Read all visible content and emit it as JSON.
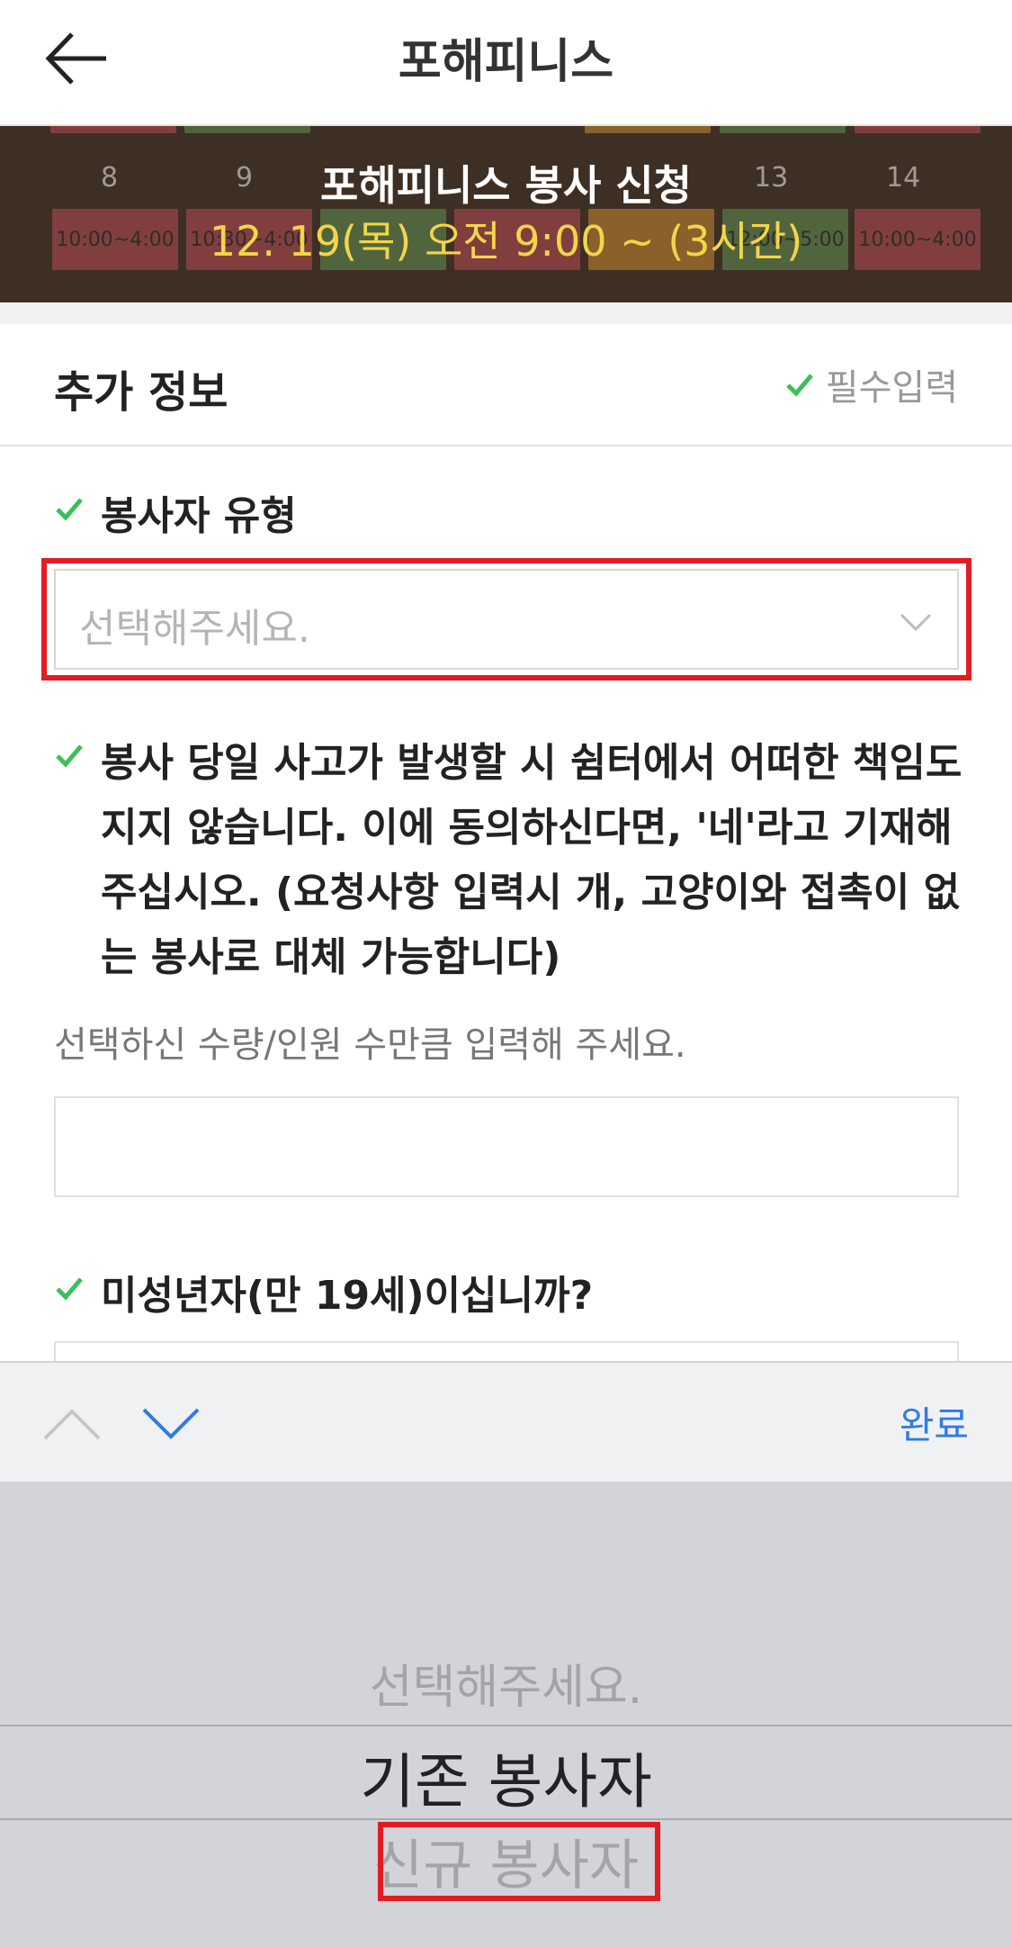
{
  "header": {
    "title": "포해피니스",
    "back_icon": "arrow-left-icon"
  },
  "banner": {
    "title": "포해피니스 봉사 신청",
    "subtitle": "12. 19(목) 오전 9:00 ~ (3시간)",
    "calendar_numbers": [
      "8",
      "9",
      "13",
      "14"
    ],
    "calendar_times": [
      "10:00~4:00",
      "10:30~4:00",
      "12:00~5:00",
      "10:00~4:00"
    ],
    "colors": {
      "red": "#c2575c",
      "green": "#6b9b5a",
      "orange": "#d4923a",
      "title": "#ffffff",
      "subtitle": "#f3d54a"
    }
  },
  "section": {
    "title": "추가 정보",
    "required_label": "필수입력"
  },
  "fields": {
    "volunteer_type": {
      "label": "봉사자 유형",
      "placeholder": "선택해주세요."
    },
    "agreement": {
      "label": "봉사 당일 사고가 발생할 시 쉼터에서 어떠한 책임도 지지 않습니다. 이에 동의하신다면, '네'라고 기재해 주십시오. (요청사항 입력시 개, 고양이와 접촉이 없는 봉사로 대체 가능합니다)",
      "hint": "선택하신 수량/인원 수만큼 입력해 주세요.",
      "value": ""
    },
    "minor": {
      "label": "미성년자(만 19세)이십니까?"
    }
  },
  "keyboard_toolbar": {
    "done_label": "완료"
  },
  "picker": {
    "options": [
      "선택해주세요.",
      "기존 봉사자",
      "신규 봉사자"
    ],
    "selected": "기존 봉사자"
  },
  "colors": {
    "check": "#3cbf5a",
    "accent_blue": "#2f7be6",
    "highlight": "#e31c24"
  }
}
